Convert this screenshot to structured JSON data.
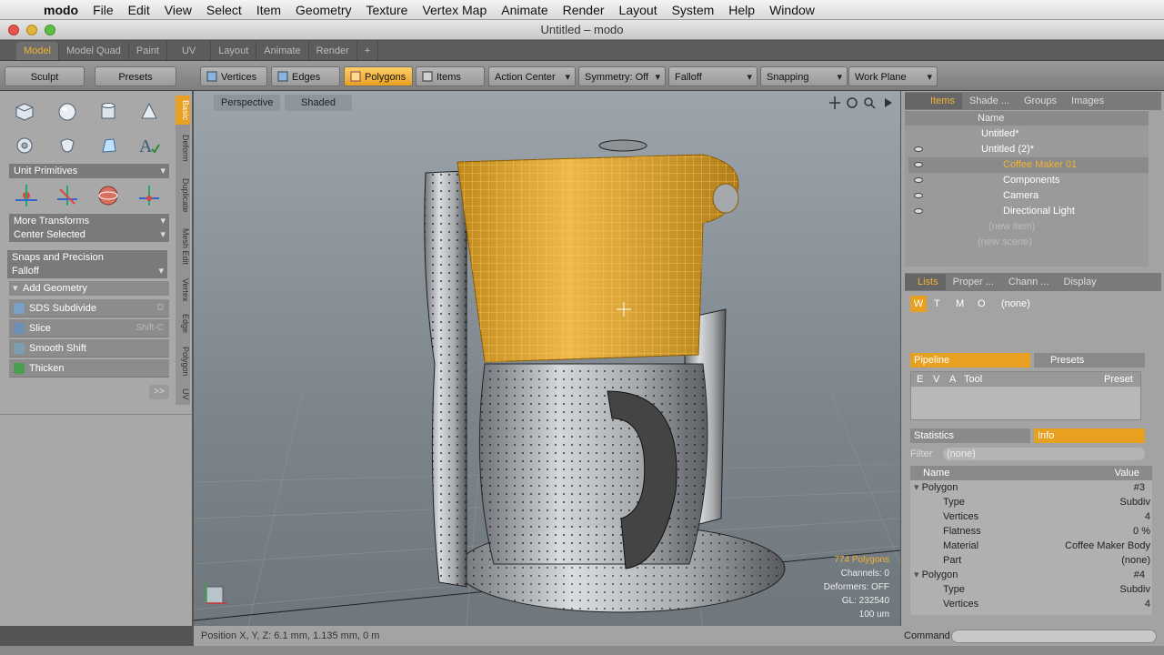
{
  "menubar": {
    "items": [
      "modo",
      "File",
      "Edit",
      "View",
      "Select",
      "Item",
      "Geometry",
      "Texture",
      "Vertex Map",
      "Animate",
      "Render",
      "Layout",
      "System",
      "Help",
      "Window"
    ]
  },
  "window": {
    "title": "Untitled – modo"
  },
  "layout_tabs": [
    "Model",
    "Model Quad",
    "Paint",
    "UV",
    "Layout",
    "Animate",
    "Render",
    "+"
  ],
  "toolbar": {
    "sculpt": "Sculpt",
    "presets": "Presets",
    "vertices": "Vertices",
    "edges": "Edges",
    "polygons": "Polygons",
    "items": "Items",
    "action_center": "Action Center",
    "symmetry": "Symmetry: Off",
    "falloff": "Falloff",
    "snapping": "Snapping",
    "work_plane": "Work Plane"
  },
  "left_panel": {
    "unit_primitives": "Unit Primitives",
    "more_transforms": "More Transforms",
    "center_selected": "Center Selected",
    "snaps_and_precision": "Snaps and Precision",
    "falloff": "Falloff",
    "add_geometry": "Add Geometry",
    "tools": [
      {
        "label": "SDS Subdivide",
        "shortcut": "D"
      },
      {
        "label": "Slice",
        "shortcut": "Shift-C"
      },
      {
        "label": "Smooth Shift",
        "shortcut": ""
      },
      {
        "label": "Thicken",
        "shortcut": ""
      }
    ],
    "more": ">>",
    "vertical_tabs": [
      "Basic",
      "Deform",
      "Duplicate",
      "Mesh Edit",
      "Vertex",
      "Edge",
      "Polygon",
      "UV"
    ]
  },
  "viewport": {
    "view_mode": "Perspective",
    "shading": "Shaded",
    "stats": [
      "774 Polygons",
      "Channels: 0",
      "Deformers: OFF",
      "GL: 232540",
      "100 um"
    ]
  },
  "status": {
    "position": "Position X, Y, Z:   6.1 mm, 1.135 mm, 0 m"
  },
  "right_panel": {
    "top_tabs": [
      "Items",
      "Shade ...",
      "Groups",
      "Images"
    ],
    "name_header": "Name",
    "items": [
      {
        "label": "Untitled*"
      },
      {
        "label": "Untitled (2)*"
      },
      {
        "label": "Coffee Maker 01"
      },
      {
        "label": "Components"
      },
      {
        "label": "Camera"
      },
      {
        "label": "Directional Light"
      },
      {
        "label": "(new item)"
      },
      {
        "label": "(new scene)"
      }
    ],
    "mid_tabs": [
      "Lists",
      "Proper ...",
      "Chann ...",
      "Display"
    ],
    "wtmo": [
      "W",
      "T",
      "M",
      "O"
    ],
    "wtmo_value": "(none)",
    "pipeline_tabs": [
      "Pipeline",
      "Presets"
    ],
    "pipeline_cols": [
      "E",
      "V",
      "A",
      "Tool",
      "Preset"
    ],
    "stats_tabs": [
      "Statistics",
      "Info"
    ],
    "filter_label": "Filter",
    "filter_value": "(none)",
    "props_header": {
      "name": "Name",
      "value": "Value"
    },
    "props": [
      {
        "name": "Polygon",
        "value": "#3"
      },
      {
        "name": "Type",
        "value": "Subdiv"
      },
      {
        "name": "Vertices",
        "value": "4"
      },
      {
        "name": "Flatness",
        "value": "0 %"
      },
      {
        "name": "Material",
        "value": "Coffee Maker Body"
      },
      {
        "name": "Part",
        "value": "(none)"
      },
      {
        "name": "Polygon",
        "value": "#4"
      },
      {
        "name": "Type",
        "value": "Subdiv"
      },
      {
        "name": "Vertices",
        "value": "4"
      }
    ]
  },
  "command": {
    "label": "Command"
  },
  "colors": {
    "accent": "#f0b330",
    "selection": "#e8a020"
  }
}
